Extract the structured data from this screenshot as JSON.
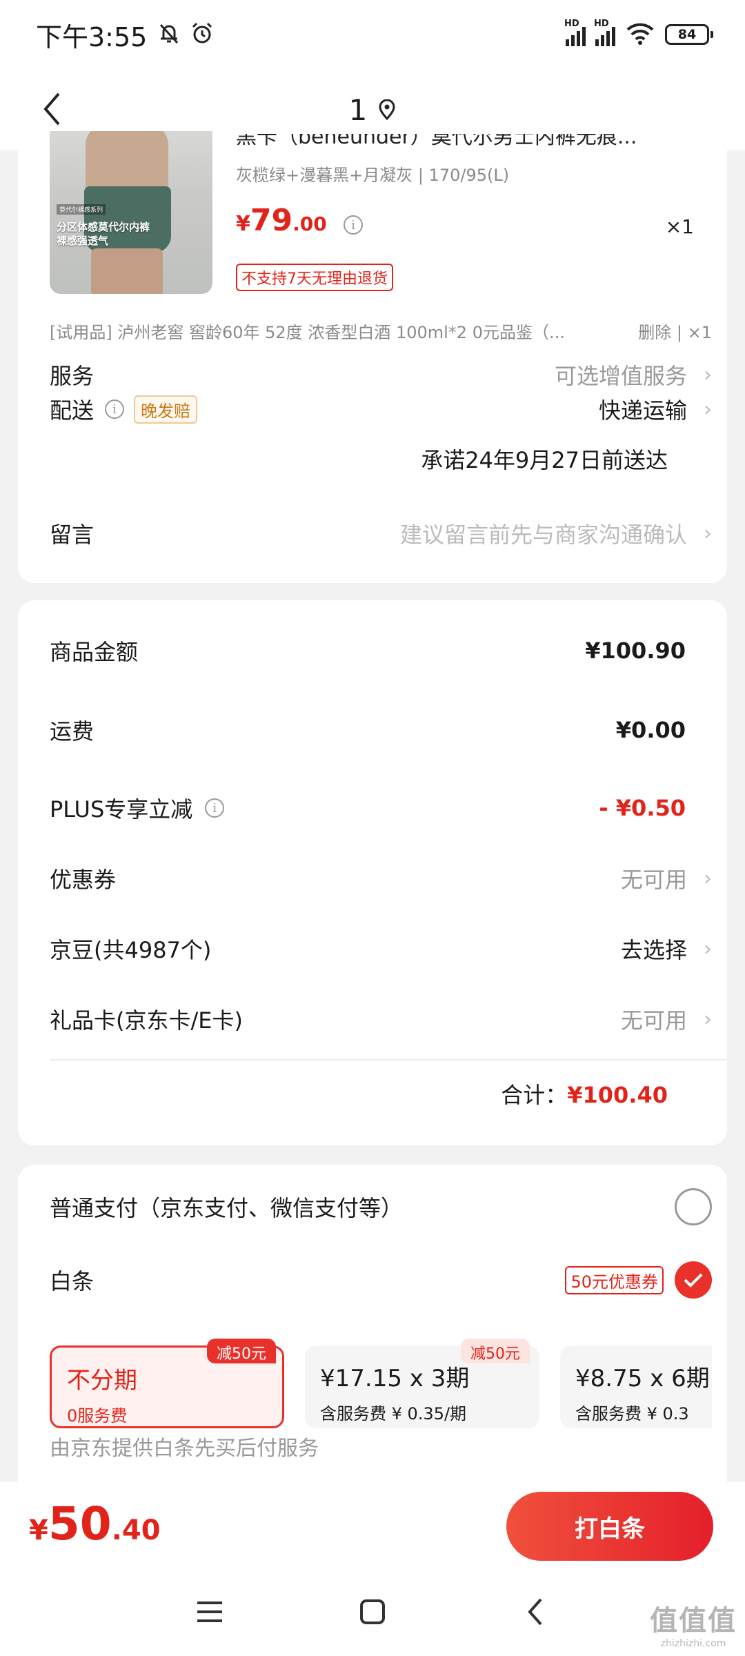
{
  "status_bar": {
    "time": "下午3:55",
    "battery": "84",
    "hd1": "HD",
    "hd2": "HD"
  },
  "nav": {
    "title": "1"
  },
  "product": {
    "name": "黑卡（beneunder）莫代尔男士内裤无痕...",
    "spec": "灰榄绿+漫暮黑+月凝灰 | 170/95(L)",
    "price_currency": "¥",
    "price_int": "79",
    "price_dec": ".00",
    "qty": "×1",
    "no_return": "不支持7天无理由退货",
    "image_text": "分区体感莫代尔内裤\n裸感强透气",
    "image_tag": "莫代尔裸感系列"
  },
  "trial": {
    "text": "[试用品]  泸州老窖 窖龄60年 52度 浓香型白酒 100ml*2 0元品鉴（...",
    "delete": "删除 | ×1"
  },
  "service": {
    "label": "服务",
    "value": "可选增值服务"
  },
  "delivery": {
    "label": "配送",
    "badge": "晚发赔",
    "value": "快递运输",
    "promise": "承诺24年9月27日前送达"
  },
  "message": {
    "label": "留言",
    "placeholder": "建议留言前先与商家沟通确认"
  },
  "summary": {
    "goods_label": "商品金额",
    "goods_value": "¥100.90",
    "shipping_label": "运费",
    "shipping_value": "¥0.00",
    "plus_label": "PLUS专享立减",
    "plus_value": "- ¥0.50",
    "coupon_label": "优惠券",
    "coupon_value": "无可用",
    "jingdou_label": "京豆(共4987个)",
    "jingdou_value": "去选择",
    "giftcard_label": "礼品卡(京东卡/E卡)",
    "giftcard_value": "无可用",
    "total_label": "合计：",
    "total_value": "¥100.40"
  },
  "payment": {
    "normal_label": "普通支付（京东支付、微信支付等）",
    "baitiao_label": "白条",
    "baitiao_coupon": "50元优惠券",
    "plans": [
      {
        "title": "不分期",
        "sub": "0服务费",
        "badge": "减50元"
      },
      {
        "title": "¥17.15 x 3期",
        "sub": "含服务费 ¥ 0.35/期",
        "badge": "减50元"
      },
      {
        "title": "¥8.75 x 6期",
        "sub": "含服务费 ¥ 0.3"
      }
    ],
    "note": "由京东提供白条先买后付服务"
  },
  "bottom": {
    "currency": "¥",
    "int": "50",
    "dec": ".40",
    "button": "打白条"
  },
  "watermark": {
    "big": "值值值",
    "small": "zhizhizhi.com"
  },
  "colors": {
    "accent": "#e2231a",
    "button": "#e8312a",
    "background": "#f2f2f2"
  }
}
